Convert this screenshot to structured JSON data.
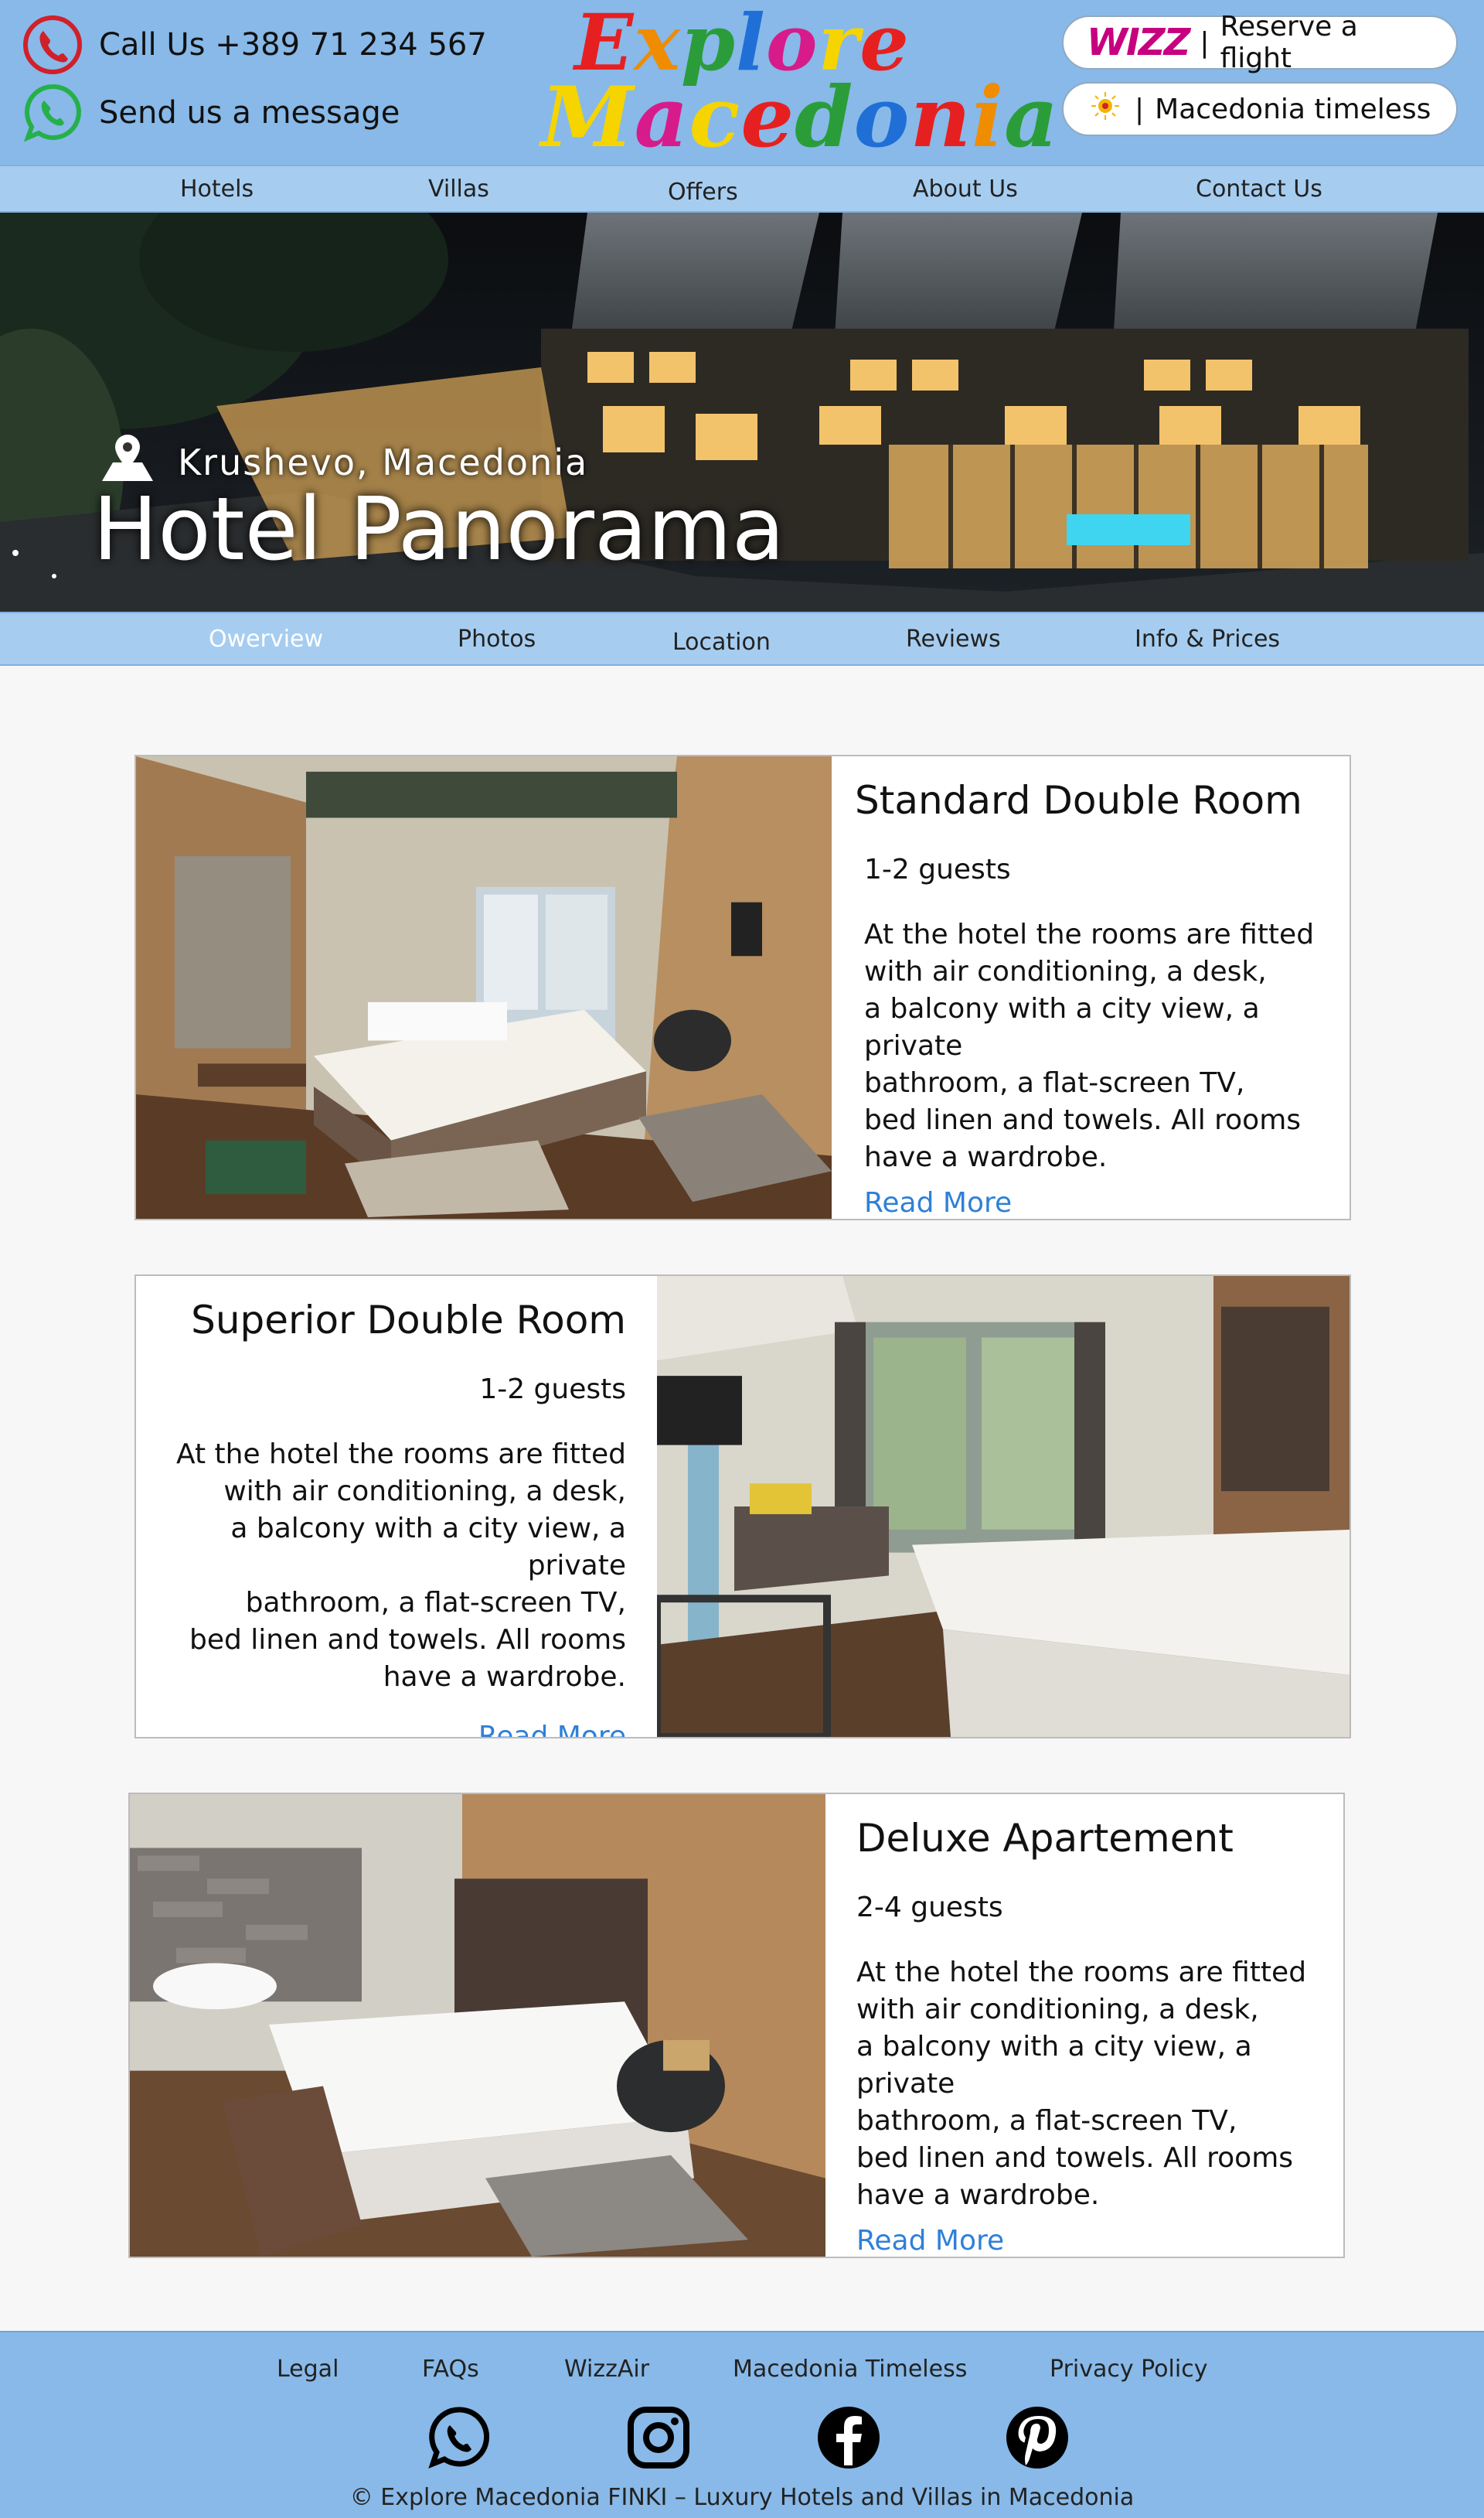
{
  "header": {
    "phone_text": "Call Us +389 71 234 567",
    "message_text": "Send us a message",
    "logo_line1": "Explore",
    "logo_line2": "Macedonia",
    "partners": [
      {
        "logo_text": "WIZZ",
        "label": "Reserve a flight"
      },
      {
        "logo_text": "",
        "label": "Macedonia timeless"
      }
    ],
    "separator": "|"
  },
  "main_nav": [
    "Hotels",
    "Villas",
    "Offers",
    "About Us",
    "Contact Us"
  ],
  "hero": {
    "location": "Krushevo, Macedonia",
    "hotel_name": "Hotel Panorama"
  },
  "sub_nav": {
    "active_index": 0,
    "items": [
      "Owerview",
      "Photos",
      "Location",
      "Reviews",
      "Info & Prices"
    ]
  },
  "rooms": [
    {
      "title": "Standard Double Room",
      "guests": "1-2 guests",
      "description": "At the hotel the rooms are fitted\nwith air conditioning, a desk,\na balcony with a city view, a private\nbathroom, a flat-screen TV,\nbed linen and towels. All rooms\nhave a wardrobe.",
      "link": "Read More"
    },
    {
      "title": "Superior Double Room",
      "guests": "1-2 guests",
      "description": "At the hotel the rooms are fitted\nwith air conditioning, a desk,\na balcony with a city view, a private\nbathroom, a flat-screen TV,\nbed linen and towels. All rooms\nhave a wardrobe.",
      "link": "Read More"
    },
    {
      "title": "Deluxe Apartement",
      "guests": "2-4 guests",
      "description": "At the hotel the rooms are fitted\nwith air conditioning, a desk,\na balcony with a city view, a private\nbathroom, a flat-screen TV,\nbed linen and towels. All rooms\nhave a wardrobe.",
      "link": "Read More"
    }
  ],
  "footer": {
    "links": [
      "Legal",
      "FAQs",
      "WizzAir",
      "Macedonia Timeless",
      "Privacy Policy"
    ],
    "social_icons": [
      "whatsapp-icon",
      "instagram-icon",
      "facebook-icon",
      "pinterest-icon"
    ],
    "copyright": "© Explore Macedonia FINKI – Luxury Hotels and Villas in Macedonia"
  },
  "colors": {
    "header_bg": "#88b9e8",
    "nav_bg": "#a6cdf0",
    "link_blue": "#2f80d8",
    "phone_red": "#d0202a",
    "whatsapp_green": "#25b04a",
    "wizz_magenta": "#c6007e"
  }
}
